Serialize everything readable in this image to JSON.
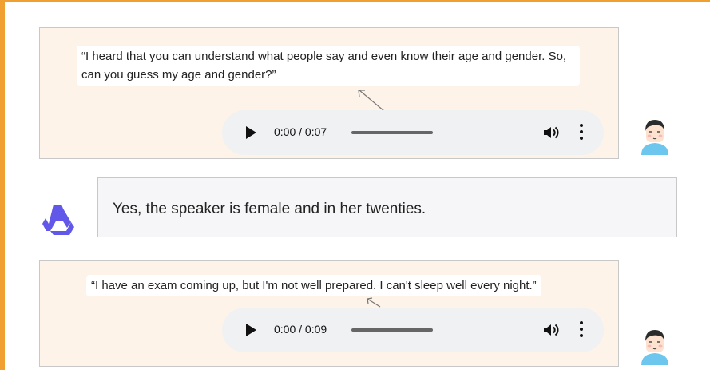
{
  "messages": [
    {
      "role": "user",
      "quote": "“I heard that you can understand what people say and even know their age and gender. So, can you guess my age and gender?”",
      "audio": {
        "time": "0:00 / 0:07"
      }
    },
    {
      "role": "assistant",
      "text": "Yes, the speaker is female and in her twenties."
    },
    {
      "role": "user",
      "quote": "“I have an exam coming up, but I'm not well prepared. I can't sleep well every night.”",
      "audio": {
        "time": "0:00 / 0:09"
      }
    }
  ],
  "icons": {
    "play": "play-icon",
    "volume": "volume-icon",
    "more": "more-vertical-icon",
    "user_avatar": "user-avatar-icon",
    "assistant_logo": "qwen-logo-icon"
  },
  "colors": {
    "frame": "#f0a030",
    "user_bubble_bg": "#fdf3e8",
    "assistant_bubble_bg": "#f6f6f8",
    "logo": "#6157e8",
    "avatar_shirt": "#6cc6ee"
  }
}
